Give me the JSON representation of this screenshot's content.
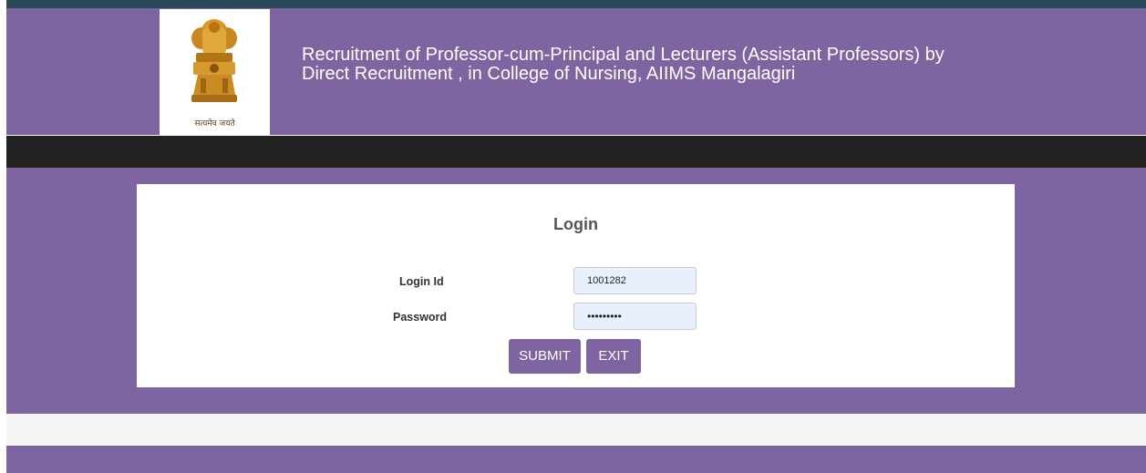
{
  "header": {
    "title_line1": "Recruitment of Professor-cum-Principal and Lecturers (Assistant Professors) by",
    "title_line2": "Direct Recruitment , in College of Nursing, AIIMS Mangalagiri",
    "emblem_motto": "सत्यमेव जयते"
  },
  "login": {
    "heading": "Login",
    "login_id_label": "Login Id",
    "login_id_value": "1001282",
    "password_label": "Password",
    "password_value": "•••••••••",
    "submit_label": "SUBMIT",
    "exit_label": "EXIT"
  },
  "colors": {
    "brand_purple": "#7e65a1",
    "navbar": "#222222",
    "input_bg": "#e8f0fe"
  },
  "icons": {
    "emblem": "national-emblem-icon"
  }
}
